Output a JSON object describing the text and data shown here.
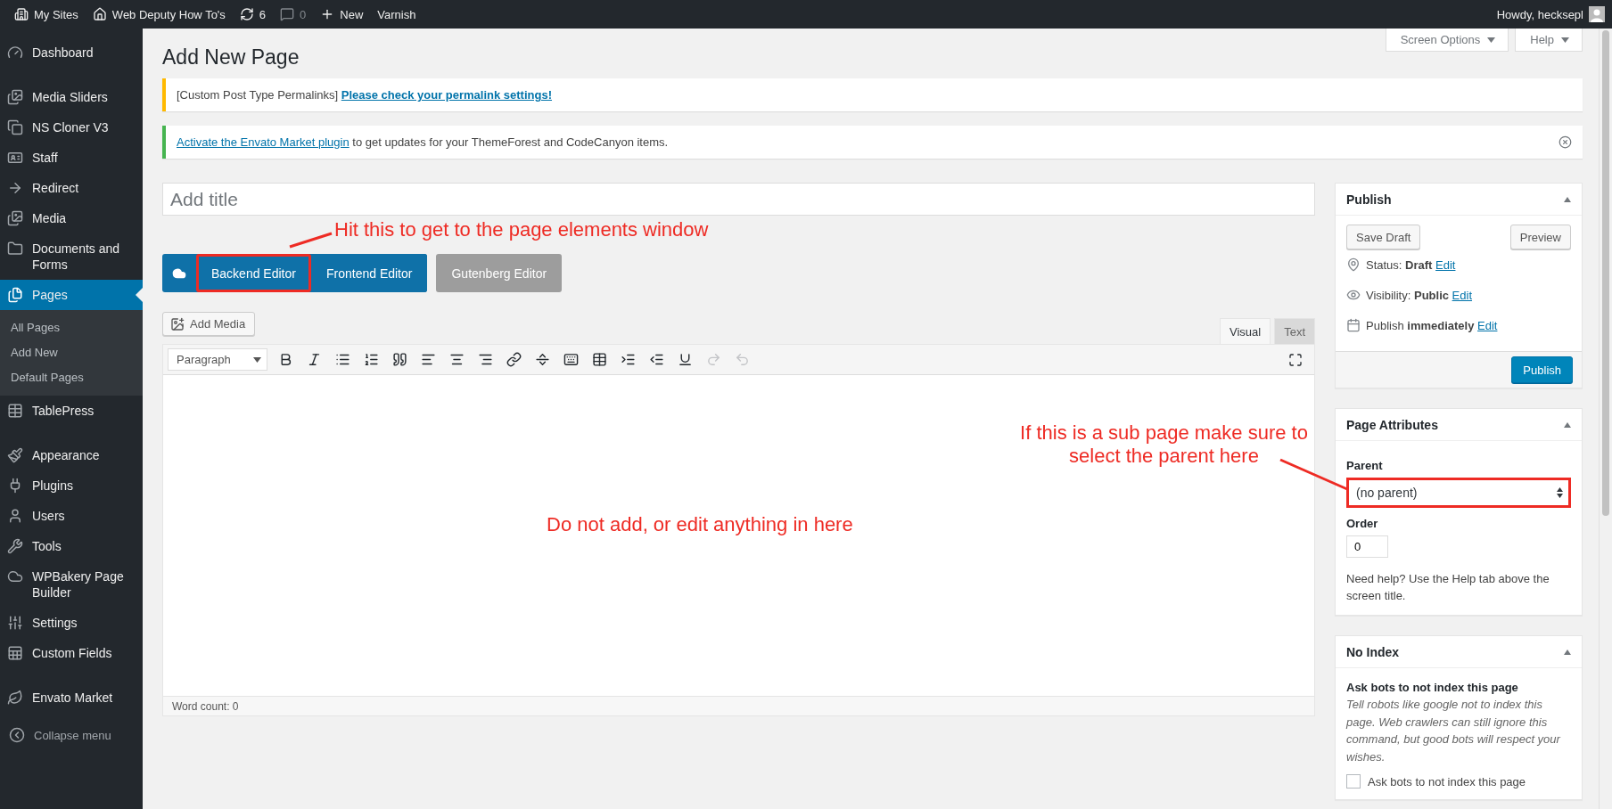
{
  "admin_bar": {
    "items": [
      {
        "label": "My Sites",
        "muted": false
      },
      {
        "label": "Web Deputy How To's",
        "muted": false
      },
      {
        "label": "6",
        "muted": false
      },
      {
        "label": "0",
        "muted": true
      },
      {
        "label": "New",
        "muted": false
      },
      {
        "label": "Varnish",
        "muted": false
      }
    ],
    "greeting": "Howdy, hecksepl"
  },
  "sidebar": {
    "groups": [
      [
        {
          "label": "Dashboard",
          "selected": false
        }
      ],
      [
        {
          "label": "Media Sliders",
          "selected": false
        },
        {
          "label": "NS Cloner V3",
          "selected": false
        },
        {
          "label": "Staff",
          "selected": false
        },
        {
          "label": "Redirect",
          "selected": false
        },
        {
          "label": "Media",
          "selected": false
        },
        {
          "label": "Documents and Forms",
          "selected": false
        },
        {
          "label": "Pages",
          "selected": true,
          "children": [
            {
              "label": "All Pages",
              "selected": false
            },
            {
              "label": "Add New",
              "selected": false
            },
            {
              "label": "Default Pages",
              "selected": false
            }
          ]
        },
        {
          "label": "TablePress",
          "selected": false
        }
      ],
      [
        {
          "label": "Appearance",
          "selected": false
        },
        {
          "label": "Plugins",
          "selected": false
        },
        {
          "label": "Users",
          "selected": false
        },
        {
          "label": "Tools",
          "selected": false
        },
        {
          "label": "WPBakery Page Builder",
          "selected": false
        },
        {
          "label": "Settings",
          "selected": false
        },
        {
          "label": "Custom Fields",
          "selected": false
        }
      ],
      [
        {
          "label": "Envato Market",
          "selected": false
        }
      ]
    ],
    "collapse": "Collapse menu"
  },
  "screen_tabs": [
    "Screen Options",
    "Help"
  ],
  "heading": "Add New Page",
  "notices": [
    {
      "kind": "warning",
      "dismissible": false,
      "parts": [
        {
          "kind": "plain",
          "text": "[Custom Post Type Permalinks]"
        },
        {
          "kind": "bold_link",
          "text": "Please check your permalink settings!"
        }
      ]
    },
    {
      "kind": "success",
      "dismissible": true,
      "parts": [
        {
          "kind": "link",
          "text": "Activate the Envato Market plugin"
        },
        {
          "kind": "plain",
          "text": "to get updates for your ThemeForest and CodeCanyon items."
        }
      ]
    }
  ],
  "title_field": {
    "placeholder": "Add title"
  },
  "editor_switch": [
    {
      "label": "Backend Editor",
      "disabled": false,
      "highlighted": true
    },
    {
      "label": "Frontend Editor",
      "disabled": false,
      "highlighted": false
    },
    {
      "label": "Gutenberg Editor",
      "disabled": true,
      "highlighted": false
    }
  ],
  "add_media": "Add Media",
  "editor_tabs": [
    {
      "label": "Visual",
      "selected": true
    },
    {
      "label": "Text",
      "selected": false
    }
  ],
  "toolbar": {
    "format": "Paragraph",
    "buttons": [
      {
        "disabled": false
      },
      {
        "disabled": false
      },
      {
        "disabled": false
      },
      {
        "disabled": false
      },
      {
        "disabled": false
      },
      {
        "disabled": false
      },
      {
        "disabled": false
      },
      {
        "disabled": false
      },
      {
        "disabled": false
      },
      {
        "disabled": false
      },
      {
        "disabled": false
      },
      {
        "disabled": false
      },
      {
        "disabled": false
      },
      {
        "disabled": false
      },
      {
        "disabled": false
      },
      {
        "disabled": true
      },
      {
        "disabled": true
      }
    ]
  },
  "word_count": "Word count: 0",
  "publish": {
    "title": "Publish",
    "save_draft": "Save Draft",
    "preview": "Preview",
    "rows": [
      {
        "label": "Status:",
        "value": "Draft",
        "link": "Edit"
      },
      {
        "label": "Visibility:",
        "value": "Public",
        "link": "Edit"
      },
      {
        "label": "Publish",
        "value": "immediately",
        "link": "Edit"
      }
    ],
    "button": "Publish"
  },
  "page_attributes": {
    "title": "Page Attributes",
    "parent_label": "Parent",
    "parent_value": "(no parent)",
    "parent_highlighted": true,
    "order_label": "Order",
    "order_value": "0",
    "help": "Need help? Use the Help tab above the screen title."
  },
  "no_index": {
    "title": "No Index",
    "heading": "Ask bots to not index this page",
    "description": "Tell robots like google not to index this page. Web crawlers can still ignore this command, but good bots will respect your wishes.",
    "checkbox_label": "Ask bots to not index this page",
    "checked": false
  },
  "annotations": [
    {
      "kind": "backend",
      "lines": [
        "Hit this to get to the page elements window"
      ]
    },
    {
      "kind": "parent",
      "lines": [
        "If this is a sub page make sure to",
        "select the parent here"
      ]
    },
    {
      "kind": "editor",
      "lines": [
        "Do not add, or edit anything in here"
      ]
    }
  ]
}
